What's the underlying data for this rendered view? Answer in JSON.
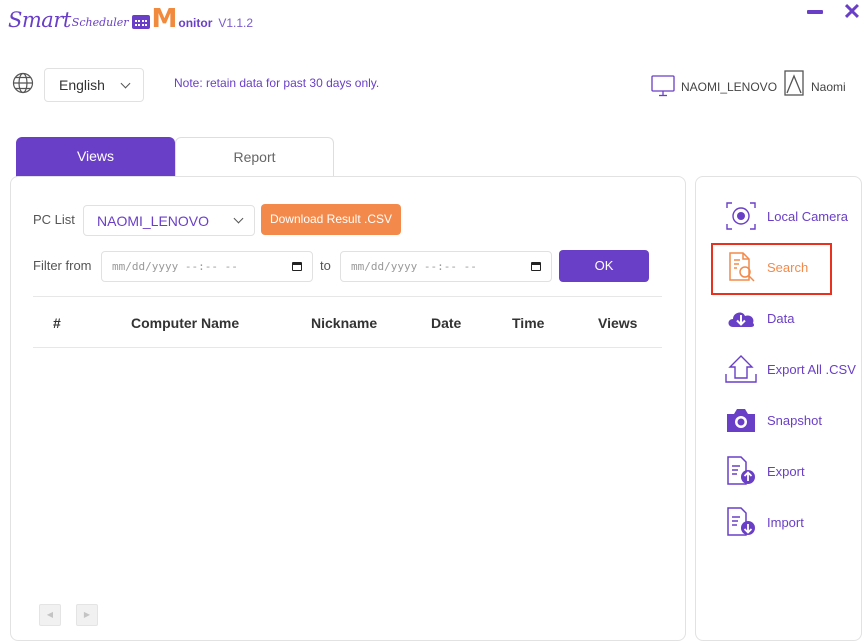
{
  "app": {
    "logo_smart": "Smart",
    "logo_scheduler": "Scheduler",
    "logo_m": "M",
    "logo_monitor": "onitor",
    "version": "V1.1.2",
    "minimize_icon": "minimize-icon",
    "close_icon": "close-icon",
    "close_glyph": "✕"
  },
  "header": {
    "language": "English",
    "note": "Note: retain data for past 30 days only.",
    "computer_name": "NAOMI_LENOVO",
    "user_name": "Naomi"
  },
  "tabs": [
    {
      "label": "Views",
      "active": true
    },
    {
      "label": "Report",
      "active": false
    }
  ],
  "filters": {
    "pc_list_label": "PC List",
    "pc_selected": "NAOMI_LENOVO",
    "download_label": "Download Result .CSV",
    "filter_from_label": "Filter from",
    "from_placeholder": "mm/dd/yyyy --:-- --",
    "to_label": "to",
    "to_placeholder": "mm/dd/yyyy --:-- --",
    "ok_label": "OK"
  },
  "table": {
    "columns": [
      "#",
      "Computer Name",
      "Nickname",
      "Date",
      "Time",
      "Views"
    ],
    "rows": []
  },
  "pager": {
    "prev": "◀",
    "next": "▶"
  },
  "sidebar": {
    "items": [
      {
        "label": "Local Camera",
        "icon": "camera-lens-icon"
      },
      {
        "label": "Search",
        "icon": "search-document-icon",
        "highlighted": true
      },
      {
        "label": "Data",
        "icon": "cloud-download-icon"
      },
      {
        "label": "Export All .CSV",
        "icon": "export-upload-icon"
      },
      {
        "label": "Snapshot",
        "icon": "snapshot-camera-icon"
      },
      {
        "label": "Export",
        "icon": "export-document-icon"
      },
      {
        "label": "Import",
        "icon": "import-document-icon"
      }
    ]
  },
  "colors": {
    "primary": "#6a3fc7",
    "accent": "#f38a4b",
    "highlight": "#e8311f"
  }
}
